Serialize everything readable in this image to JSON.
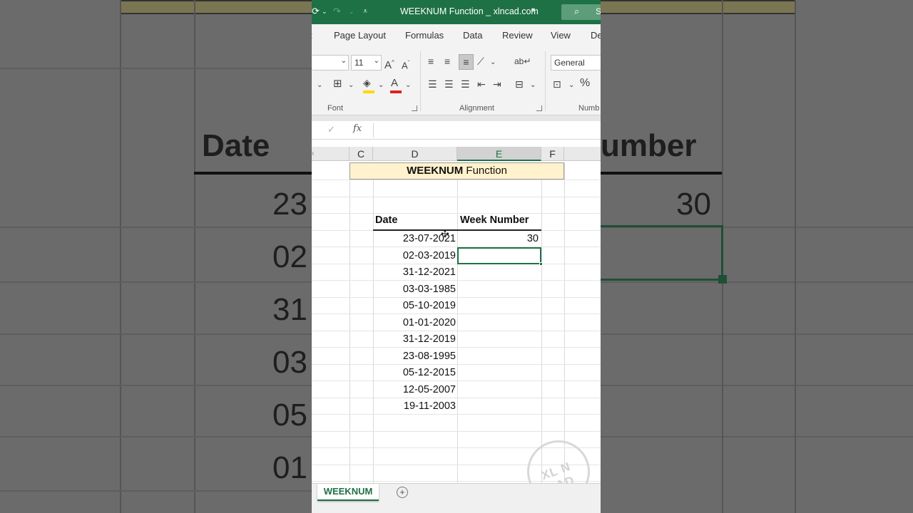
{
  "window": {
    "title": "WEEKNUM Function _ xlncad.com",
    "search_label": "S"
  },
  "ribbon_tabs": [
    "Page Layout",
    "Formulas",
    "Data",
    "Review",
    "View",
    "De"
  ],
  "ribbon": {
    "font_size": "11",
    "number_format": "General",
    "groups": {
      "font": "Font",
      "alignment": "Alignment",
      "number": "Numb"
    },
    "colors": {
      "fill": "#ffd800",
      "font": "#e02020",
      "accent": "#1e7145"
    }
  },
  "formula_bar": {
    "fx": "fx",
    "content": ""
  },
  "columns": [
    "C",
    "D",
    "E",
    "F"
  ],
  "selected_column": "E",
  "sheet": {
    "title_bold": "WEEKNUM",
    "title_rest": " Function",
    "headers": {
      "date": "Date",
      "week": "Week Number"
    },
    "rows": [
      {
        "date": "23-07-2021",
        "week": "30"
      },
      {
        "date": "02-03-2019",
        "week": ""
      },
      {
        "date": "31-12-2021",
        "week": ""
      },
      {
        "date": "03-03-1985",
        "week": ""
      },
      {
        "date": "05-10-2019",
        "week": ""
      },
      {
        "date": "01-01-2020",
        "week": ""
      },
      {
        "date": "31-12-2019",
        "week": ""
      },
      {
        "date": "23-08-1995",
        "week": ""
      },
      {
        "date": "05-12-2015",
        "week": ""
      },
      {
        "date": "12-05-2007",
        "week": ""
      },
      {
        "date": "19-11-2003",
        "week": ""
      }
    ]
  },
  "sheet_tab": "WEEKNUM",
  "watermark": "XL N CAD",
  "background": {
    "left_header": "Date",
    "right_header": "umber",
    "right_value": "30",
    "left_values": [
      "23",
      "02",
      "31",
      "03",
      "05",
      "01"
    ]
  }
}
